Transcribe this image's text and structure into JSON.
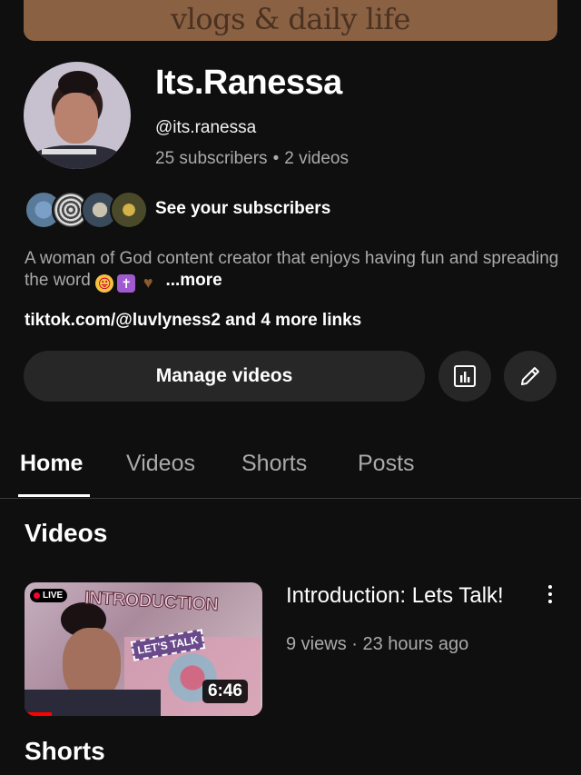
{
  "banner": {
    "text": "vlogs & daily life"
  },
  "channel": {
    "name": "Its.Ranessa",
    "handle": "@its.ranessa",
    "subscribers": "25 subscribers",
    "separator": "•",
    "videos": "2 videos",
    "see_subscribers": "See your subscribers",
    "description": "A woman of God content creator that enjoys having fun and spreading the word",
    "more": "...more",
    "links": "tiktok.com/@luvlyness2 and 4 more links"
  },
  "actions": {
    "manage_videos": "Manage videos",
    "analytics_icon": "analytics-icon",
    "edit_icon": "pencil-icon"
  },
  "tabs": [
    {
      "label": "Home"
    },
    {
      "label": "Videos"
    },
    {
      "label": "Shorts"
    },
    {
      "label": "Posts"
    }
  ],
  "sections": {
    "videos_title": "Videos",
    "shorts_title": "Shorts"
  },
  "video": {
    "title": "Introduction: Lets Talk!",
    "meta": "9 views · 23 hours ago",
    "duration": "6:46",
    "badge": "LIVE",
    "thumb_title": "INTRODUCTION",
    "thumb_sticker": "LET'S TALK"
  },
  "colors": {
    "background": "#0f0f0f",
    "banner": "#8a6142",
    "button": "#272727",
    "secondary_text": "#aaaaaa",
    "progress": "#ff0000"
  }
}
